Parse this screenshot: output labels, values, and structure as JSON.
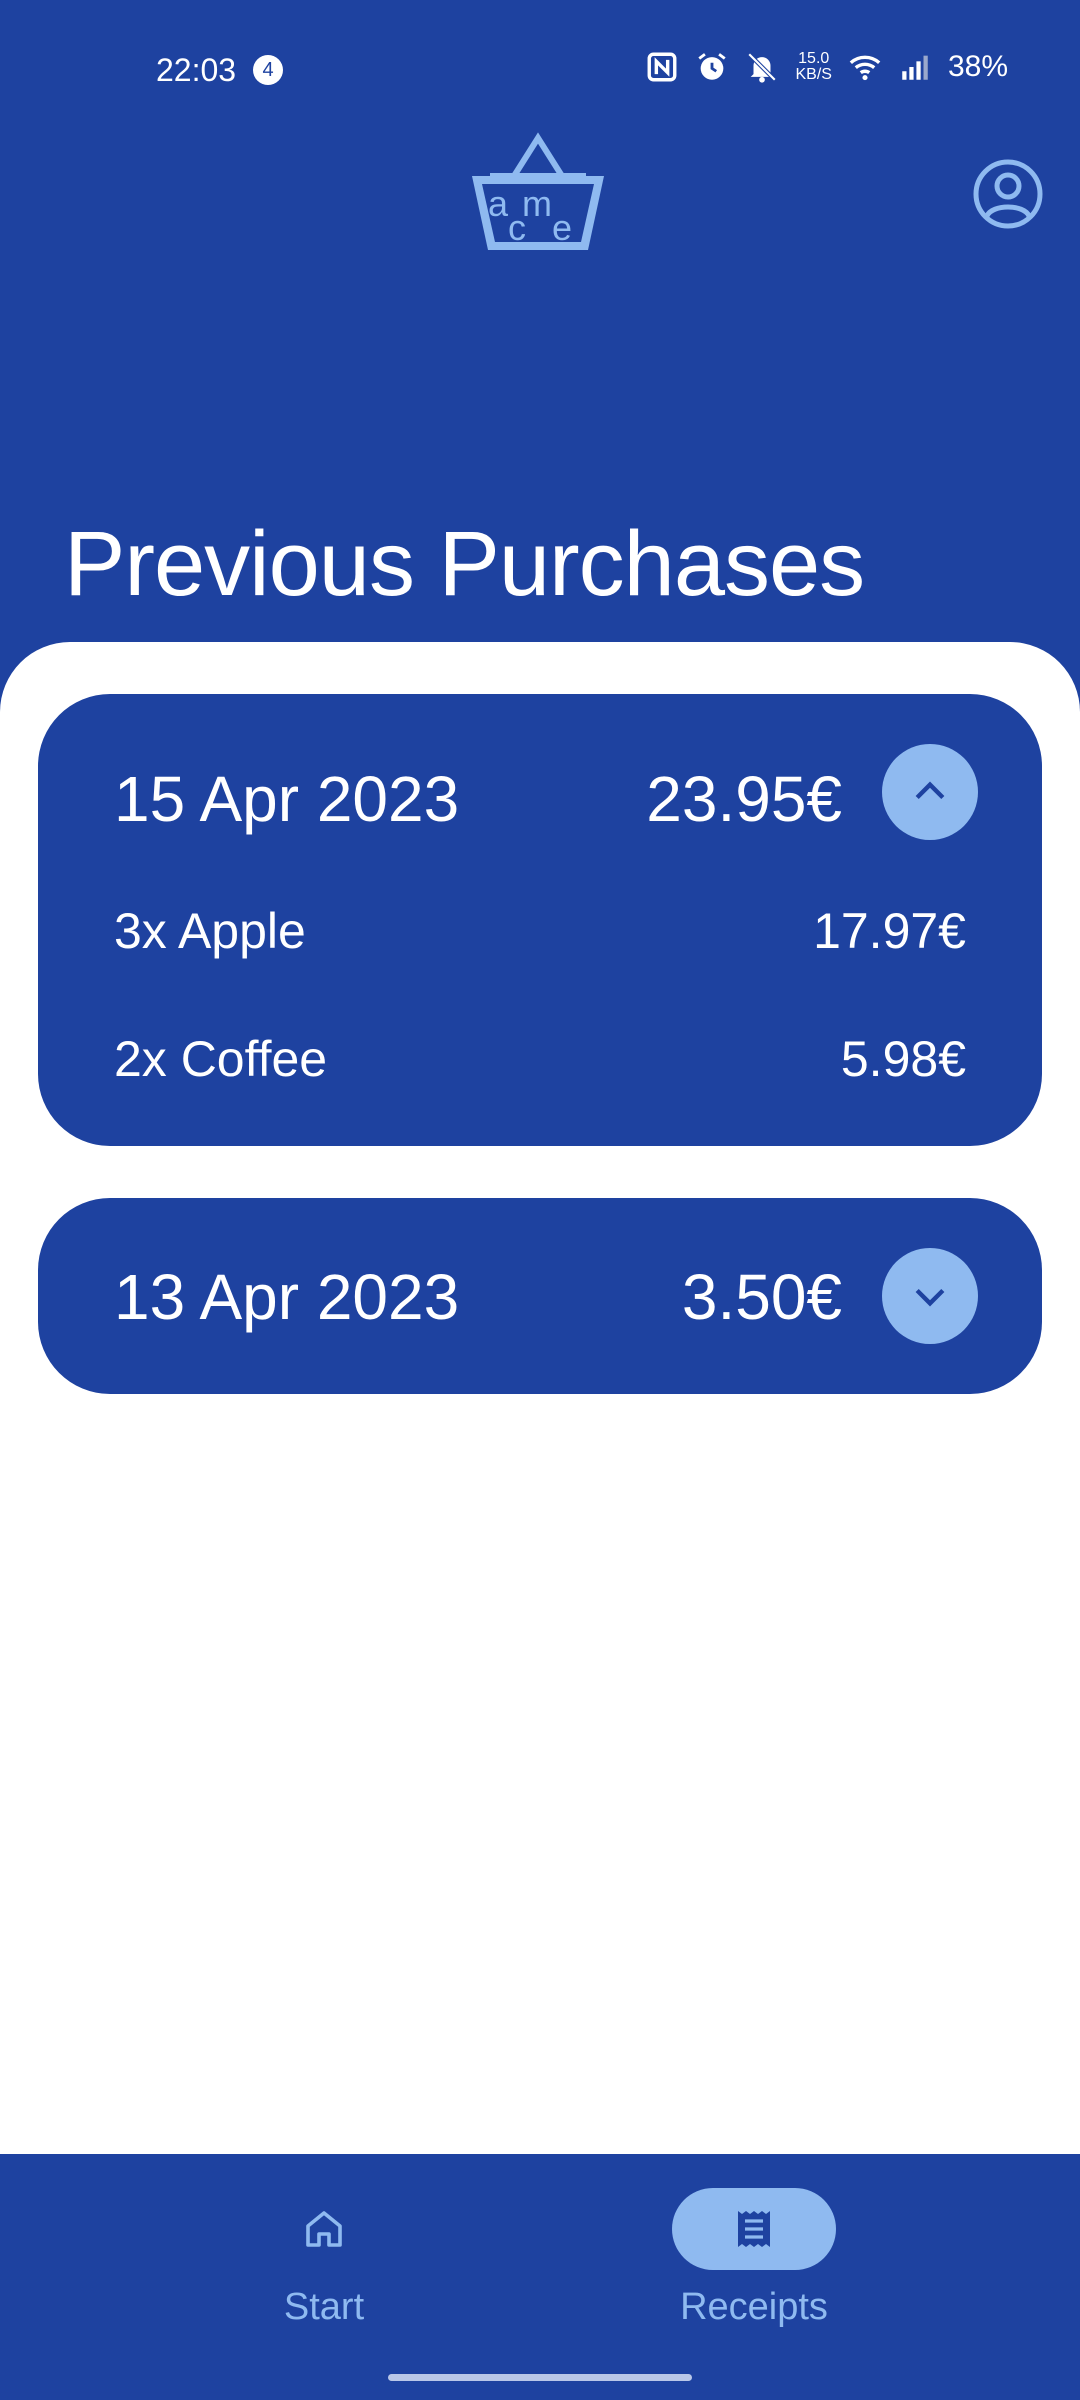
{
  "status_bar": {
    "time": "22:03",
    "notification_count": "4",
    "net_speed_value": "15.0",
    "net_speed_unit": "KB/S",
    "battery": "38%",
    "icons": [
      "nfc-icon",
      "alarm-icon",
      "silent-bell-icon",
      "wifi-icon",
      "signal-icon"
    ]
  },
  "header": {
    "logo_letters": [
      "a",
      "m",
      "c",
      "e"
    ],
    "profile_icon": "account-circle-icon"
  },
  "page": {
    "title": "Previous Purchases"
  },
  "purchases": [
    {
      "date": "15 Apr 2023",
      "total": "23.95€",
      "expanded": true,
      "toggle_icon": "chevron-up-icon",
      "items": [
        {
          "label": "3x Apple",
          "price": "17.97€"
        },
        {
          "label": "2x Coffee",
          "price": "5.98€"
        }
      ]
    },
    {
      "date": "13 Apr 2023",
      "total": "3.50€",
      "expanded": false,
      "toggle_icon": "chevron-down-icon",
      "items": []
    }
  ],
  "bottom_nav": {
    "items": [
      {
        "label": "Start",
        "icon": "home-icon",
        "active": false
      },
      {
        "label": "Receipts",
        "icon": "receipt-icon",
        "active": true
      }
    ]
  },
  "colors": {
    "primary": "#1e42a0",
    "accent": "#8fbaf0",
    "background": "#ffffff",
    "text_on_primary": "#ffffff"
  }
}
